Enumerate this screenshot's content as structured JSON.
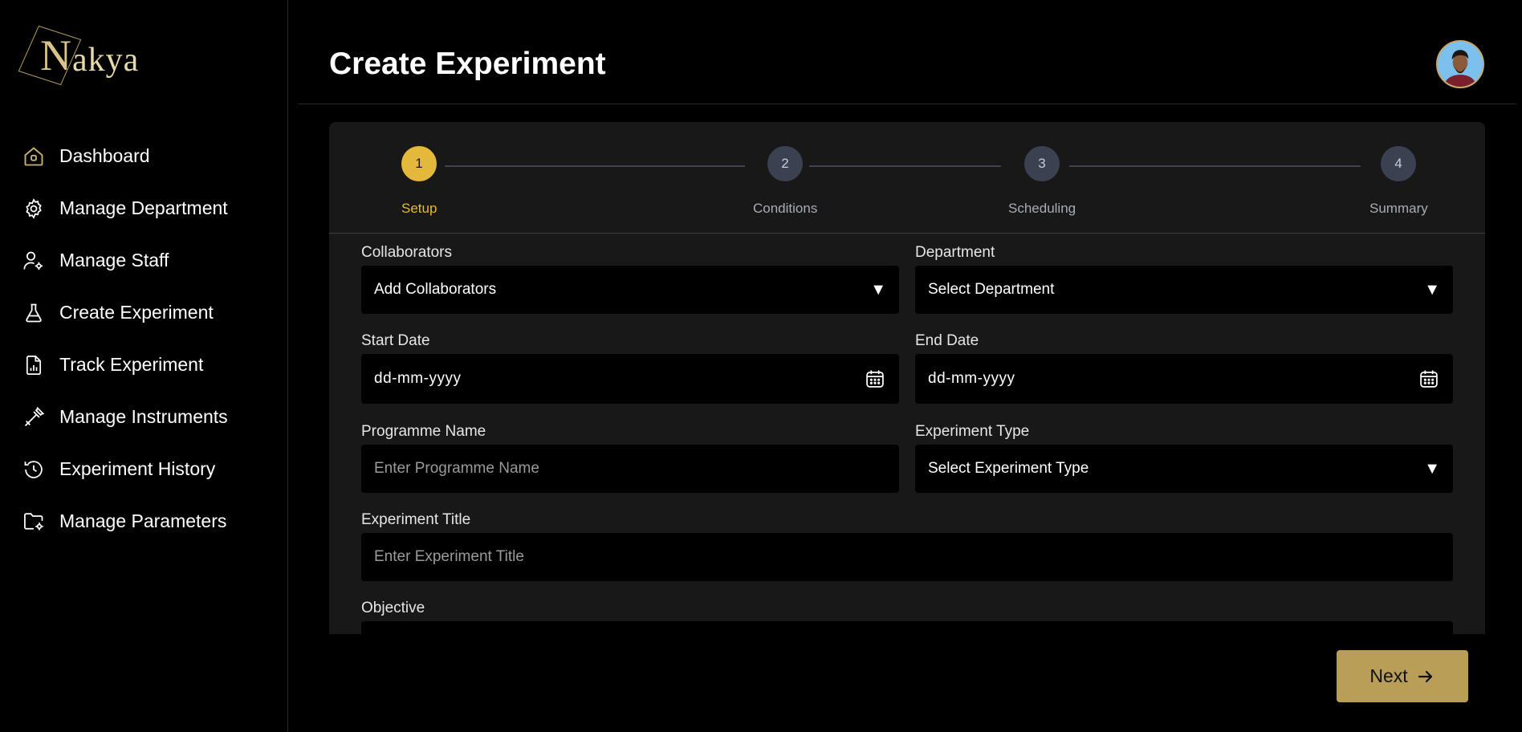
{
  "app": {
    "logo_initial": "N",
    "logo_rest": "akya"
  },
  "sidebar": {
    "items": [
      {
        "label": "Dashboard",
        "icon": "home-icon"
      },
      {
        "label": "Manage Department",
        "icon": "gear-icon"
      },
      {
        "label": "Manage Staff",
        "icon": "user-gear-icon"
      },
      {
        "label": "Create Experiment",
        "icon": "flask-icon"
      },
      {
        "label": "Track Experiment",
        "icon": "report-chart-icon"
      },
      {
        "label": "Manage Instruments",
        "icon": "pipette-icon"
      },
      {
        "label": "Experiment History",
        "icon": "history-icon"
      },
      {
        "label": "Manage Parameters",
        "icon": "folder-gear-icon"
      }
    ]
  },
  "header": {
    "title": "Create Experiment"
  },
  "stepper": {
    "steps": [
      {
        "number": "1",
        "label": "Setup",
        "active": true
      },
      {
        "number": "2",
        "label": "Conditions",
        "active": false
      },
      {
        "number": "3",
        "label": "Scheduling",
        "active": false
      },
      {
        "number": "4",
        "label": "Summary",
        "active": false
      }
    ]
  },
  "form": {
    "collaborators": {
      "label": "Collaborators",
      "value": "Add Collaborators"
    },
    "department": {
      "label": "Department",
      "value": "Select Department"
    },
    "start_date": {
      "label": "Start Date",
      "value": "dd-mm-yyyy"
    },
    "end_date": {
      "label": "End Date",
      "value": "dd-mm-yyyy"
    },
    "programme_name": {
      "label": "Programme Name",
      "placeholder": "Enter Programme Name"
    },
    "experiment_type": {
      "label": "Experiment Type",
      "value": "Select Experiment Type"
    },
    "experiment_title": {
      "label": "Experiment Title",
      "placeholder": "Enter Experiment Title"
    },
    "objective": {
      "label": "Objective"
    }
  },
  "actions": {
    "next_label": "Next"
  },
  "colors": {
    "accent": "#e4b83b",
    "button": "#b89e56",
    "card": "#181818"
  }
}
